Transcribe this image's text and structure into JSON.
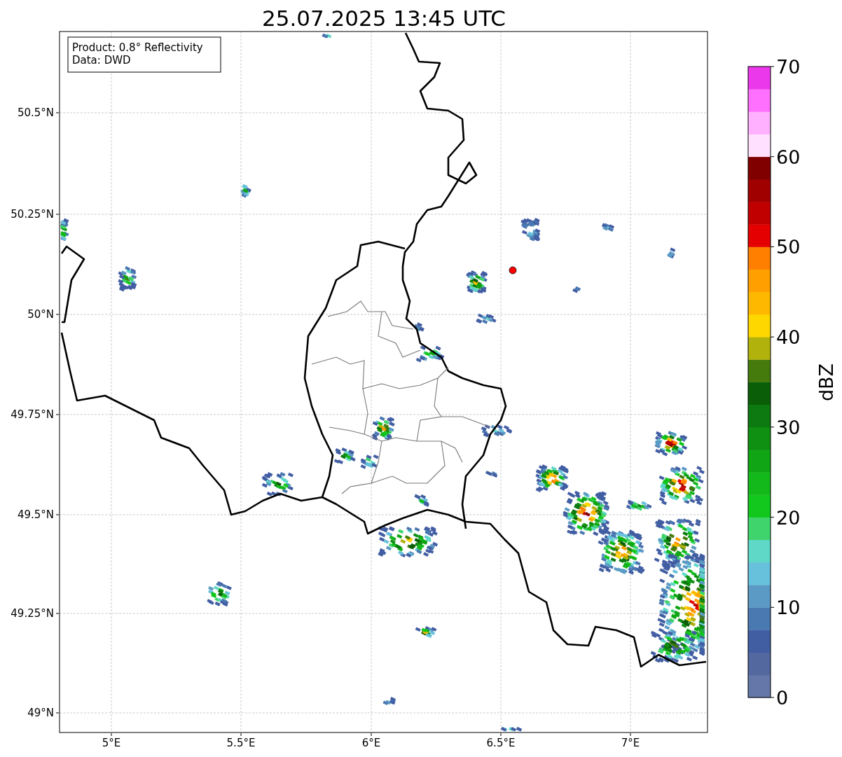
{
  "title": "25.07.2025 13:45 UTC",
  "map": {
    "legend": [
      "Product: 0.8° Reflectivity",
      "Data: DWD"
    ],
    "lat_ticks": [
      "50.5°N",
      "50.25°N",
      "50°N",
      "49.75°N",
      "49.5°N",
      "49.25°N",
      "49°N"
    ],
    "lon_ticks": [
      "5°E",
      "5.5°E",
      "6°E",
      "6.5°E",
      "7°E"
    ]
  },
  "colorbar": {
    "label": "dBZ",
    "ticks": [
      "70",
      "60",
      "50",
      "40",
      "30",
      "20",
      "10",
      "0"
    ],
    "bins": [
      {
        "color": "#6477a8"
      },
      {
        "color": "#5468a0"
      },
      {
        "color": "#425ea3"
      },
      {
        "color": "#4a78b0"
      },
      {
        "color": "#5b9ac4"
      },
      {
        "color": "#68c1dc"
      },
      {
        "color": "#5fd8c8"
      },
      {
        "color": "#3fd46c"
      },
      {
        "color": "#12c81c"
      },
      {
        "color": "#13b81a"
      },
      {
        "color": "#10a514"
      },
      {
        "color": "#0f9012"
      },
      {
        "color": "#0c7a10"
      },
      {
        "color": "#0a5e08"
      },
      {
        "color": "#457a0c"
      },
      {
        "color": "#b1b20c"
      },
      {
        "color": "#ffd700"
      },
      {
        "color": "#ffb800"
      },
      {
        "color": "#ff9f00"
      },
      {
        "color": "#ff8000"
      },
      {
        "color": "#e40000"
      },
      {
        "color": "#c00000"
      },
      {
        "color": "#a00000"
      },
      {
        "color": "#800000"
      },
      {
        "color": "#ffe0ff"
      },
      {
        "color": "#ffb0ff"
      },
      {
        "color": "#ff70ff"
      },
      {
        "color": "#ea38ea"
      }
    ]
  }
}
